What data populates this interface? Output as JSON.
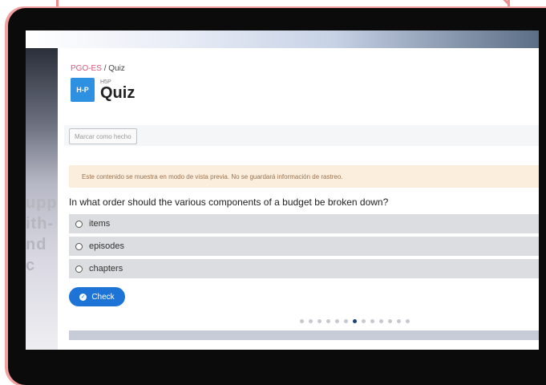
{
  "breadcrumb": {
    "course": "PGO-ES",
    "separator": "/",
    "current": "Quiz"
  },
  "badge": {
    "label": "H-P"
  },
  "header": {
    "subtitle": "H5P",
    "title": "Quiz"
  },
  "mark_button": {
    "label": "Marcar como hecho"
  },
  "notice": {
    "text": "Este contenido se muestra en modo de vista previa. No se guardará información de rastreo."
  },
  "quiz": {
    "question": "In what order should the various components of a budget be broken down?",
    "answers": [
      {
        "label": "items"
      },
      {
        "label": "episodes"
      },
      {
        "label": "chapters"
      }
    ],
    "check_label": "Check",
    "progress": {
      "total": 13,
      "current": 7
    }
  },
  "background_text": {
    "line1": "upp",
    "line2": "ith-",
    "line3": "nd c"
  },
  "colors": {
    "accent": "#1e74d6",
    "badge": "#2d90e0",
    "breadcrumb_link": "#d9547a",
    "notice_bg": "#fbeedd",
    "frame": "#0b0b0c"
  }
}
